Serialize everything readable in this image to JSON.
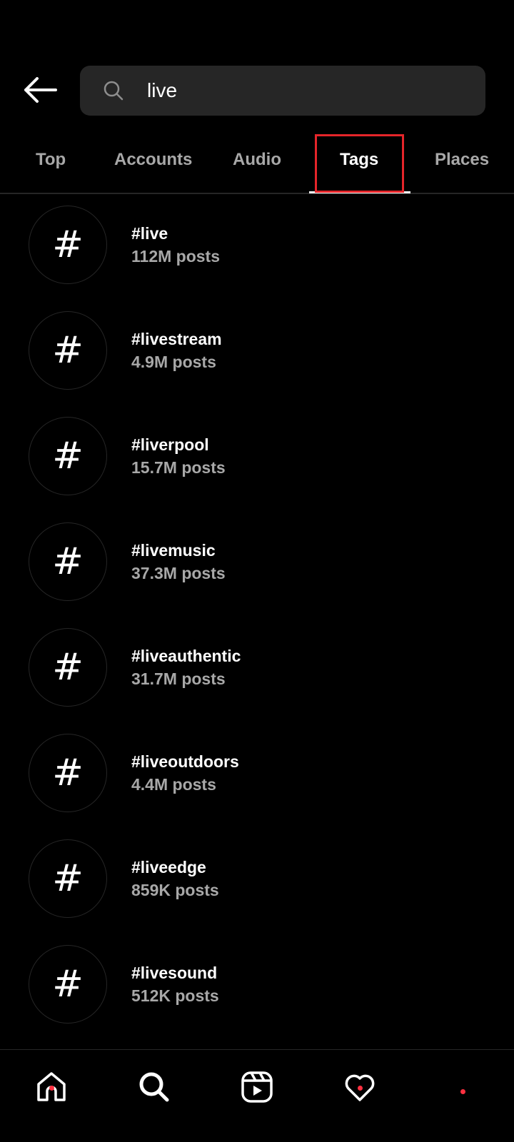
{
  "search": {
    "value": "live",
    "icon": "search-icon"
  },
  "header": {
    "back_icon": "back-arrow-icon"
  },
  "tabs": [
    {
      "label": "Top",
      "active": false
    },
    {
      "label": "Accounts",
      "active": false
    },
    {
      "label": "Audio",
      "active": false
    },
    {
      "label": "Tags",
      "active": true
    },
    {
      "label": "Places",
      "active": false
    }
  ],
  "tag_icon_glyph": "#",
  "results": [
    {
      "name": "#live",
      "count": "112M posts"
    },
    {
      "name": "#livestream",
      "count": "4.9M posts"
    },
    {
      "name": "#liverpool",
      "count": "15.7M posts"
    },
    {
      "name": "#livemusic",
      "count": "37.3M posts"
    },
    {
      "name": "#liveauthentic",
      "count": "31.7M posts"
    },
    {
      "name": "#liveoutdoors",
      "count": "4.4M posts"
    },
    {
      "name": "#liveedge",
      "count": "859K posts"
    },
    {
      "name": "#livesound",
      "count": "512K posts"
    }
  ],
  "bottom_nav": [
    {
      "icon": "home-icon",
      "notification": true
    },
    {
      "icon": "search-icon",
      "notification": false
    },
    {
      "icon": "reels-icon",
      "notification": false
    },
    {
      "icon": "heart-icon",
      "notification": true
    },
    {
      "icon": "profile-icon",
      "notification": true
    }
  ],
  "colors": {
    "background": "#000000",
    "search_bg": "#262626",
    "secondary_text": "#a8a8a8",
    "highlight": "#e5252a",
    "notification": "#ff3040"
  }
}
